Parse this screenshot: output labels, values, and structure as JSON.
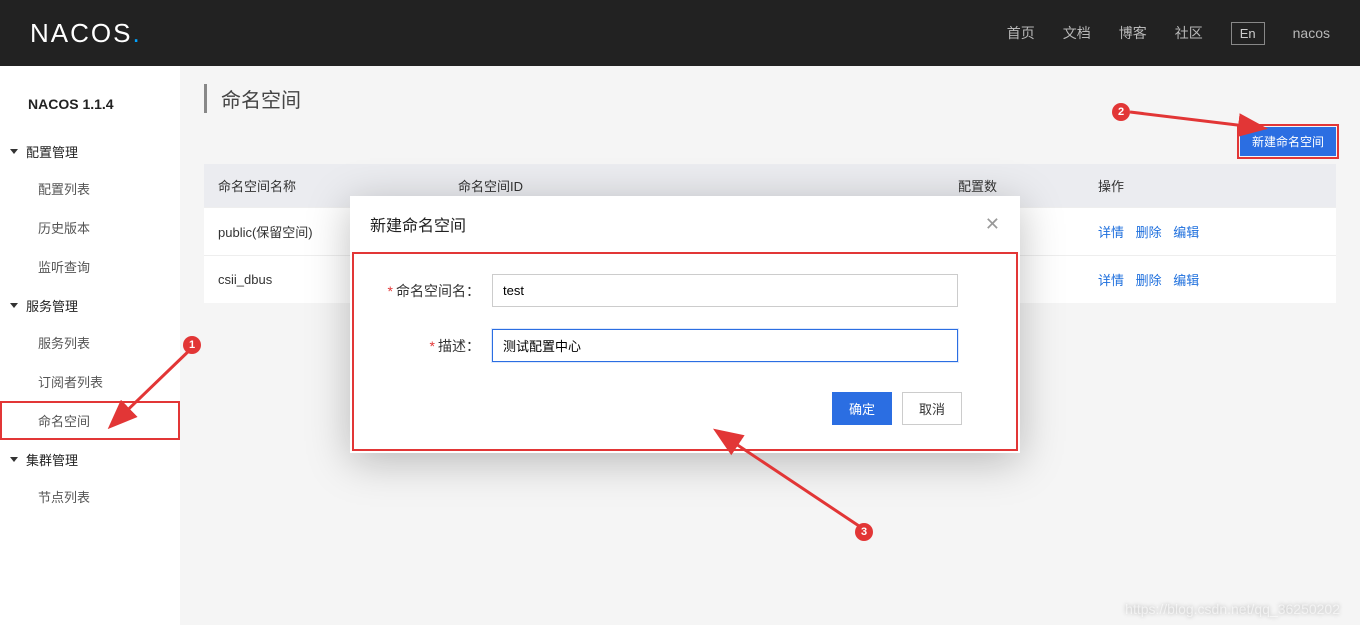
{
  "header": {
    "logo_main": "NACOS",
    "logo_dot": ".",
    "nav": {
      "home": "首页",
      "docs": "文档",
      "blog": "博客",
      "community": "社区",
      "lang": "En",
      "user": "nacos"
    }
  },
  "sidebar": {
    "version": "NACOS 1.1.4",
    "groups": {
      "config": {
        "label": "配置管理",
        "items": [
          "配置列表",
          "历史版本",
          "监听查询"
        ]
      },
      "service": {
        "label": "服务管理",
        "items": [
          "服务列表",
          "订阅者列表",
          "命名空间"
        ]
      },
      "cluster": {
        "label": "集群管理",
        "items": [
          "节点列表"
        ]
      }
    }
  },
  "page": {
    "title": "命名空间",
    "new_button": "新建命名空间"
  },
  "table": {
    "headers": {
      "name": "命名空间名称",
      "id": "命名空间ID",
      "count": "配置数",
      "ops": "操作"
    },
    "rows": [
      {
        "name": "public(保留空间)",
        "detail": "详情",
        "delete": "删除",
        "edit": "编辑"
      },
      {
        "name": "csii_dbus",
        "detail": "详情",
        "delete": "删除",
        "edit": "编辑"
      }
    ]
  },
  "modal": {
    "title": "新建命名空间",
    "name_label": "命名空间名：",
    "name_value": "test",
    "desc_label": "描述：",
    "desc_value": "测试配置中心",
    "ok": "确定",
    "cancel": "取消"
  },
  "annotations": {
    "one": "1",
    "two": "2",
    "three": "3"
  },
  "watermark": "https://blog.csdn.net/qq_36250202"
}
